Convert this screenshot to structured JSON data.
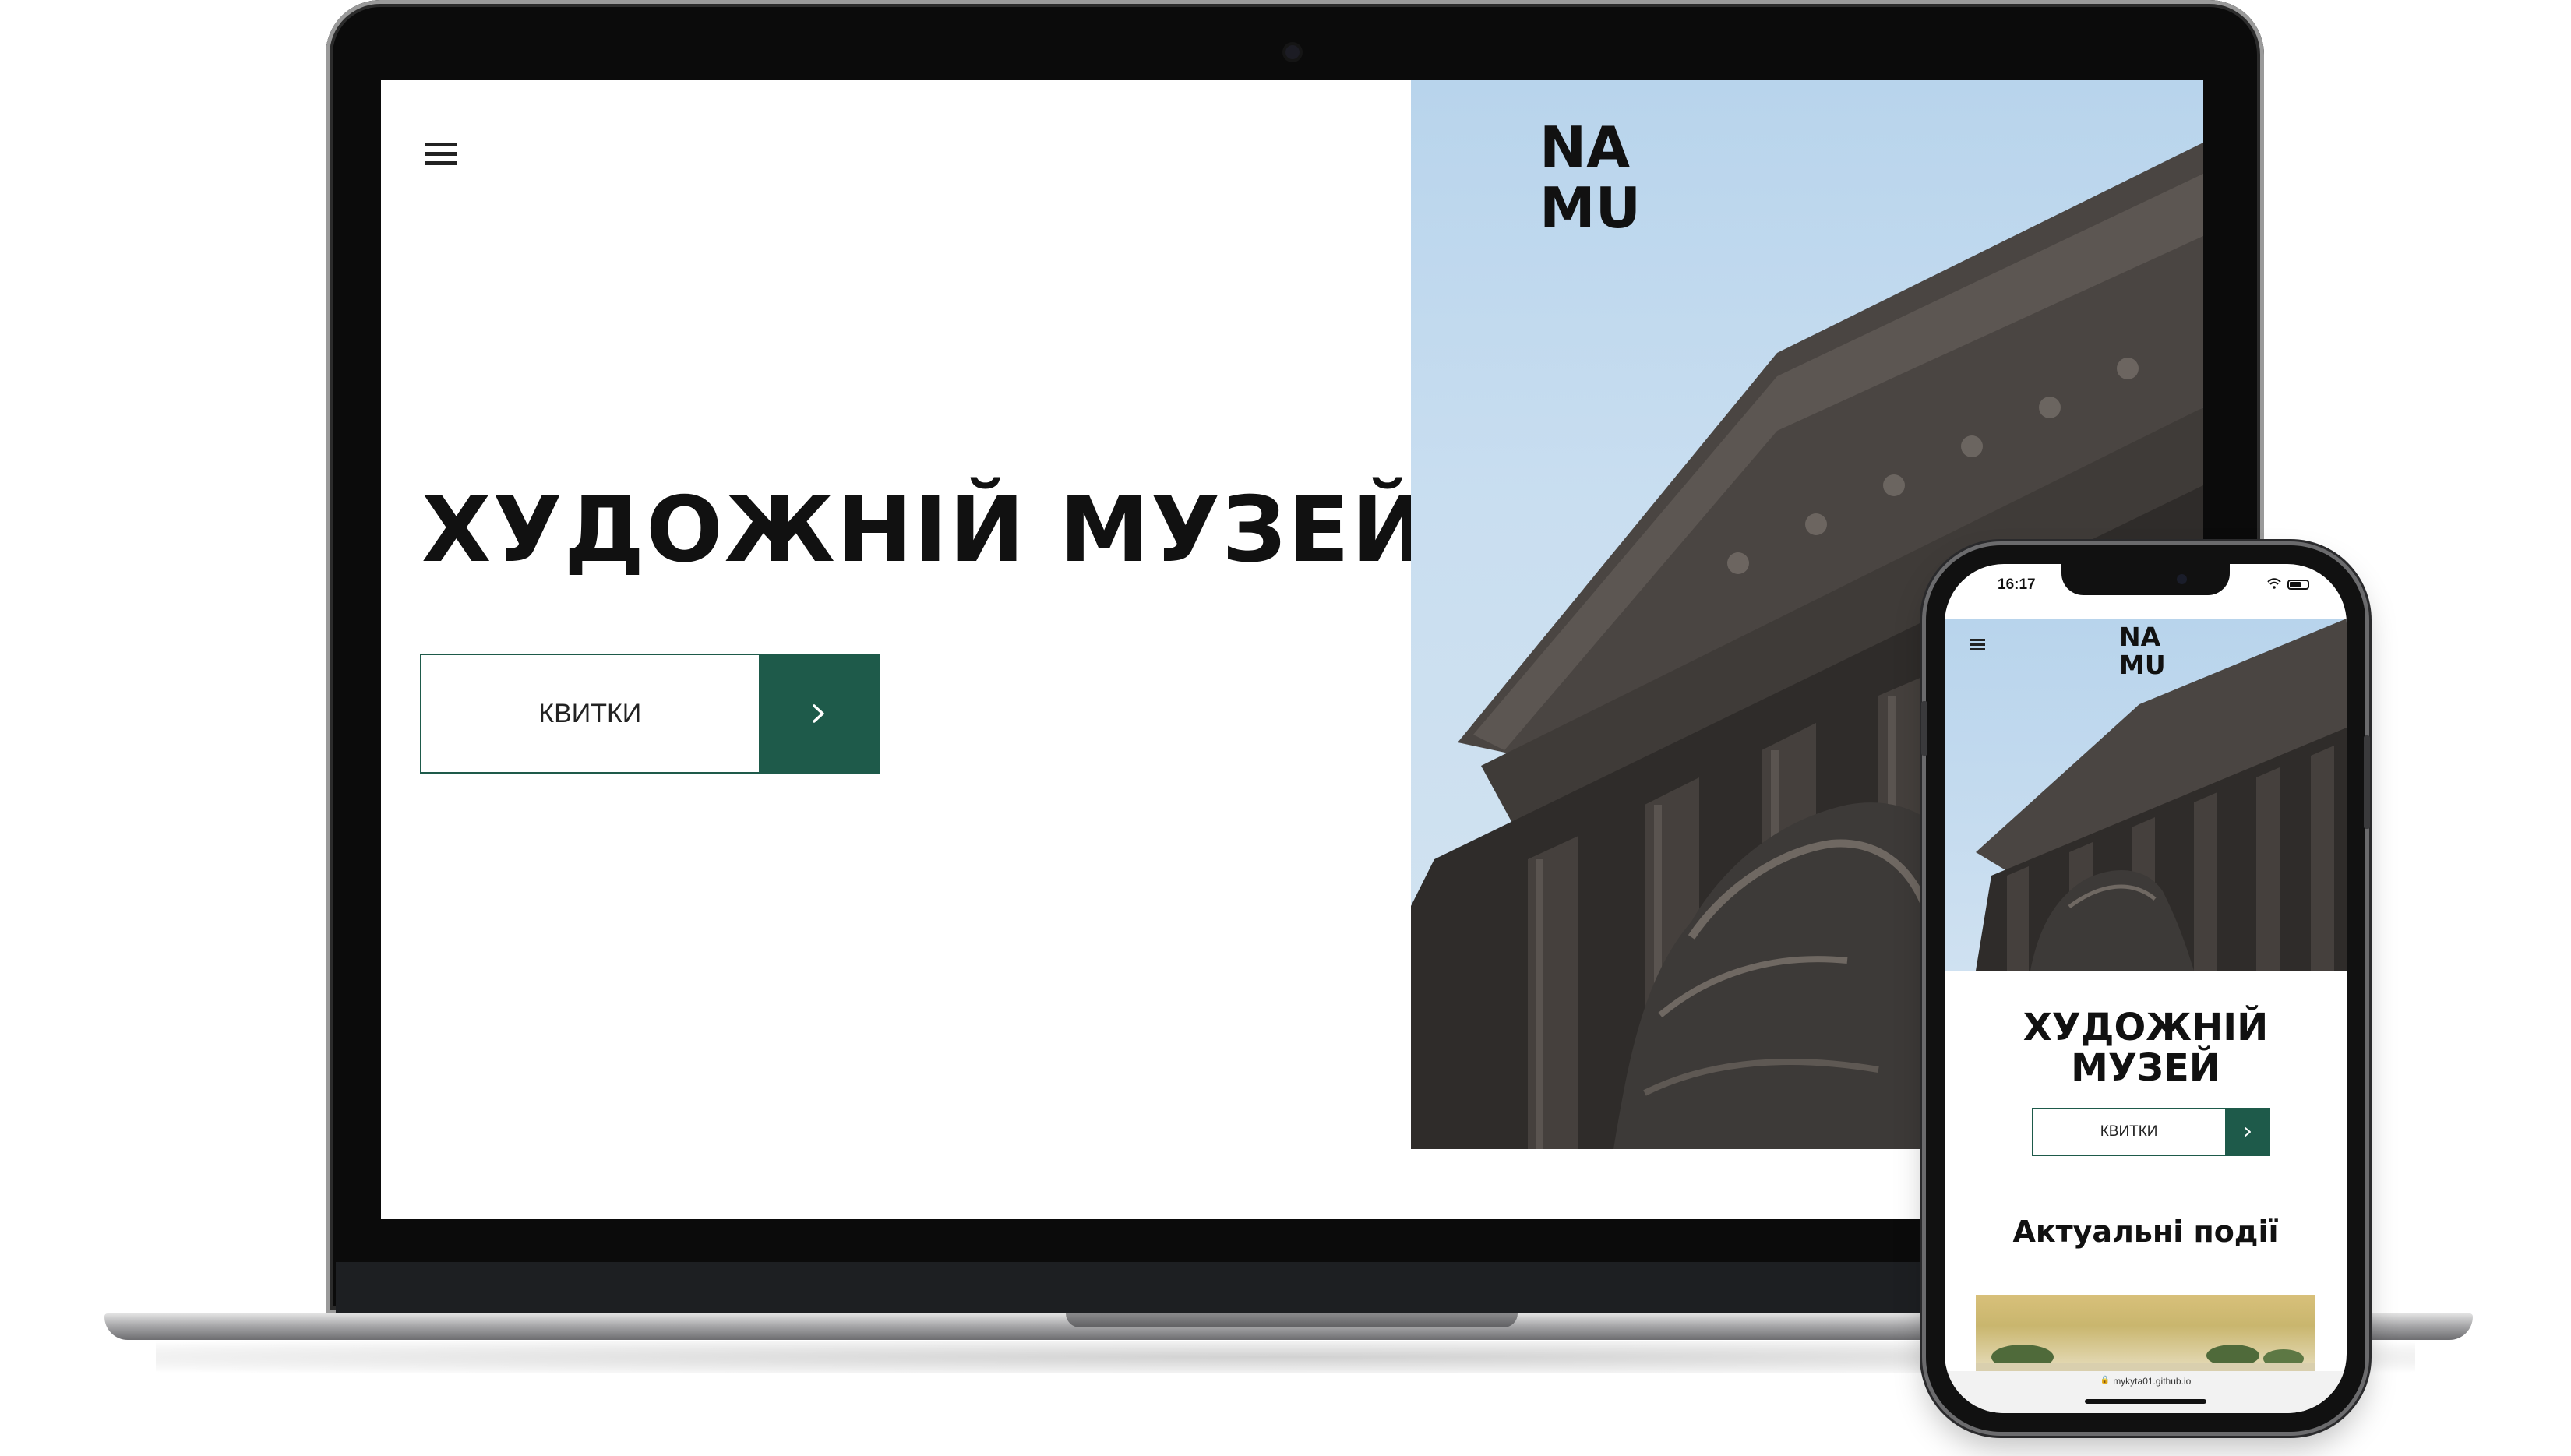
{
  "laptop": {
    "menu_icon": "hamburger-menu-icon",
    "logo_line1": "NA",
    "logo_line2": "MU",
    "hero_title": "ХУДОЖНІЙ МУЗЕЙ",
    "cta_label": "КВИТКИ",
    "cta_arrow_icon": "chevron-right-icon"
  },
  "phone": {
    "status_time": "16:17",
    "menu_icon": "hamburger-menu-icon",
    "logo_line1": "NA",
    "logo_line2": "MU",
    "hero_title_line1": "ХУДОЖНІЙ",
    "hero_title_line2": "МУЗЕЙ",
    "cta_label": "КВИТКИ",
    "cta_arrow_icon": "chevron-right-icon",
    "events_heading": "Актуальні події",
    "url": "mykyta01.github.io"
  },
  "colors": {
    "accent_green": "#1e5a4a",
    "sky": "#c9def0",
    "stone": "#3d3a38"
  }
}
